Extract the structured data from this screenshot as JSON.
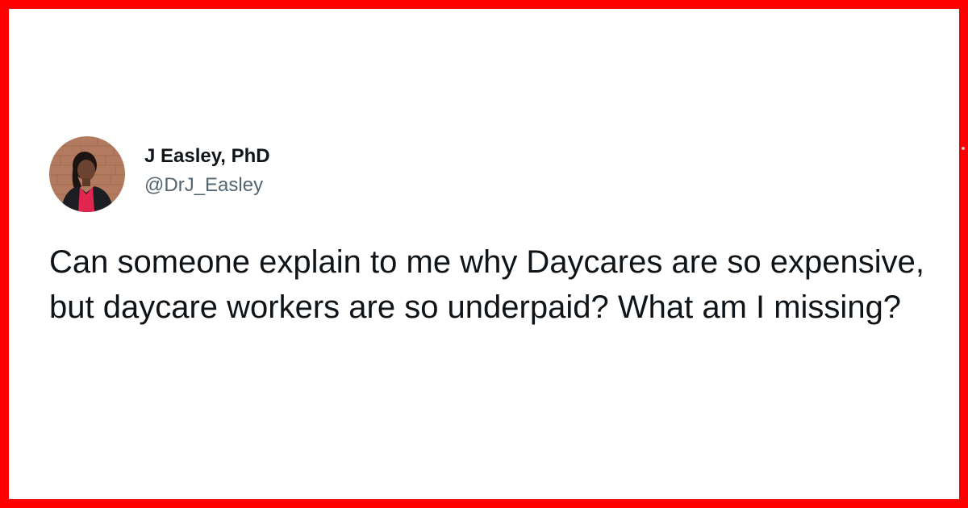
{
  "tweet": {
    "display_name": "J Easley, PhD",
    "handle": "@DrJ_Easley",
    "text": "Can someone explain to me why Daycares are so expensive, but daycare workers are so underpaid? What am I missing?"
  },
  "colors": {
    "border": "#ff0000",
    "background": "#ffffff",
    "name_text": "#0f1419",
    "handle_text": "#536471",
    "body_text": "#0f1419"
  },
  "icons": {
    "avatar": "profile-photo"
  }
}
